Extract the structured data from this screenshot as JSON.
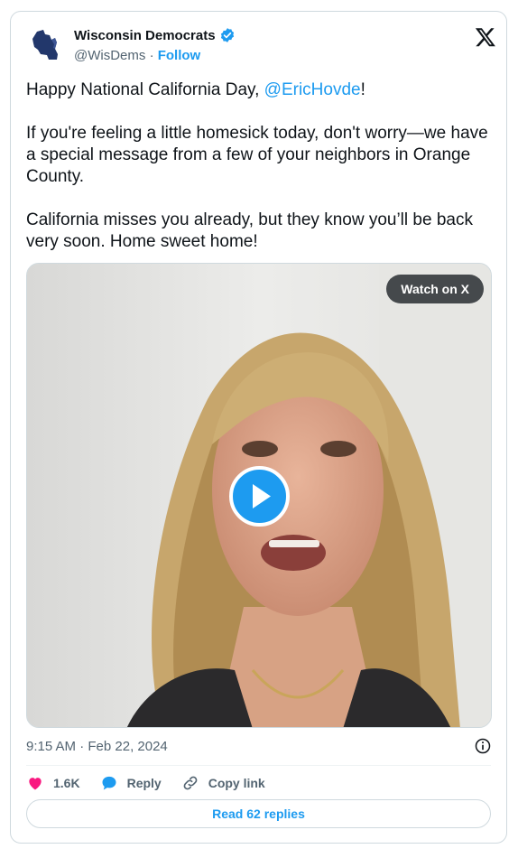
{
  "author": {
    "name": "Wisconsin Democrats",
    "handle": "@WisDems",
    "separator": "·",
    "follow_label": "Follow",
    "verified_icon": "verified-badge-icon",
    "avatar_icon": "wisconsin-map-icon"
  },
  "tweet": {
    "line1_prefix": "Happy National California Day, ",
    "line1_mention": "@EricHovde",
    "line1_suffix": "!",
    "paragraph2": "If you're feeling a little homesick today, don't worry—we have a special message from a few of your neighbors in Orange County.",
    "paragraph3": "California misses you already, but they know you’ll be back very soon. Home sweet home!"
  },
  "media": {
    "watch_label": "Watch on X",
    "play_icon": "play-icon"
  },
  "meta": {
    "timestamp": "9:15 AM · Feb 22, 2024"
  },
  "actions": {
    "likes": "1.6K",
    "reply_label": "Reply",
    "copy_label": "Copy link"
  },
  "read_replies_label": "Read 62 replies",
  "colors": {
    "accent": "#1d9bf0",
    "like": "#f91880",
    "text": "#0f1419",
    "secondary": "#536471",
    "border": "#cfd9de"
  }
}
